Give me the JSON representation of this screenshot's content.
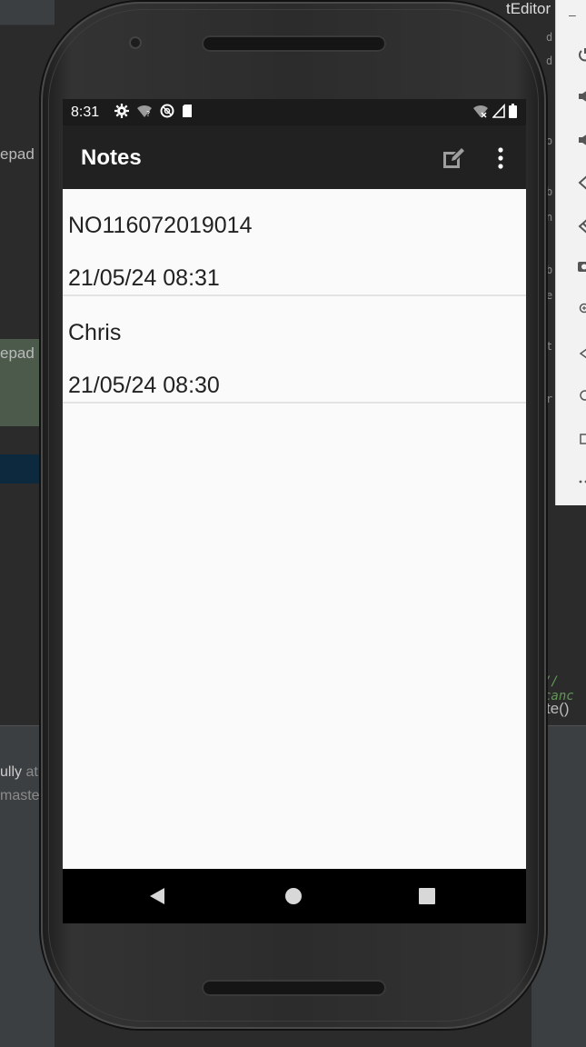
{
  "ide": {
    "editor_title": "tEditor",
    "left_labels": [
      "epad",
      "epad"
    ],
    "message_line1_a": "ully",
    "message_line1_b": " at",
    "message_line2": "maste",
    "right_code_letters": [
      "d",
      "d",
      "o",
      "b",
      "n",
      "b",
      "e",
      "t",
      "r"
    ],
    "comment_text": "// canc",
    "function_text": "te()"
  },
  "emulator_toolbar": {
    "buttons": [
      "power-icon",
      "volume-up-icon",
      "volume-down-icon",
      "rotate-left-icon",
      "rotate-right-icon",
      "camera-icon",
      "zoom-icon",
      "back-icon",
      "home-icon",
      "overview-icon",
      "more-icon"
    ]
  },
  "status_bar": {
    "time": "8:31"
  },
  "app_bar": {
    "title": "Notes"
  },
  "notes": [
    {
      "title": "NO116072019014",
      "date": "21/05/24 08:31"
    },
    {
      "title": "Chris",
      "date": "21/05/24 08:30"
    }
  ],
  "colors": {
    "app_bar": "#212121",
    "status_bar": "#1b1b1b",
    "list_background": "#fafafa",
    "divider": "#e3e3e3",
    "nav_bar": "#000000"
  }
}
